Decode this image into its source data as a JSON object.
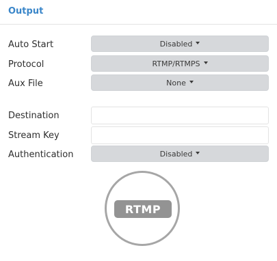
{
  "header": {
    "title": "Output"
  },
  "form": {
    "auto_start": {
      "label": "Auto Start",
      "value": "Disabled"
    },
    "protocol": {
      "label": "Protocol",
      "value": "RTMP/RTMPS"
    },
    "aux_file": {
      "label": "Aux File",
      "value": "None"
    },
    "destination": {
      "label": "Destination",
      "value": "",
      "placeholder": ""
    },
    "stream_key": {
      "label": "Stream Key",
      "value": "",
      "placeholder": ""
    },
    "authentication": {
      "label": "Authentication",
      "value": "Disabled"
    }
  },
  "logo": {
    "text": "RTMP",
    "icon": "rtmp-logo-icon"
  },
  "colors": {
    "accent": "#3a86c9",
    "dropdown_bg": "#d6d8db",
    "logo_gray": "#939393"
  }
}
